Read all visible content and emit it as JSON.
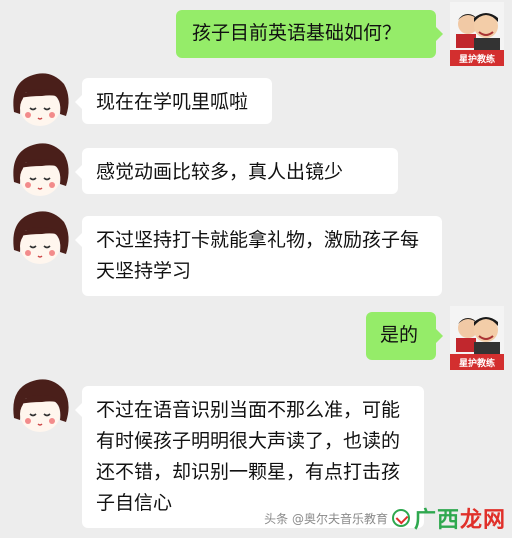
{
  "messages": [
    {
      "side": "right",
      "sender": "teacher",
      "text": "孩子目前英语基础如何？"
    },
    {
      "side": "left",
      "sender": "parent",
      "text": "现在在学叽里呱啦"
    },
    {
      "side": "left",
      "sender": "parent",
      "text": "感觉动画比较多，真人出镜少"
    },
    {
      "side": "left",
      "sender": "parent",
      "text": "不过坚持打卡就能拿礼物，激励孩子每天坚持学习"
    },
    {
      "side": "right",
      "sender": "teacher",
      "text": "是的"
    },
    {
      "side": "left",
      "sender": "parent",
      "text": "不过在语音识别当面不那么准，可能有时候孩子明明很大声读了，也读的还不错，却识别一颗星，有点打击孩子自信心"
    }
  ],
  "avatars": {
    "teacher_badge": "星护教练",
    "parent_icon": "cartoon-girl-avatar"
  },
  "watermark": {
    "source": "头条 @奥尔夫音乐教育",
    "brand_green": "广西",
    "brand_red": "龙网"
  },
  "colors": {
    "background": "#ededed",
    "bubble_right": "#95ec69",
    "bubble_left": "#ffffff"
  }
}
